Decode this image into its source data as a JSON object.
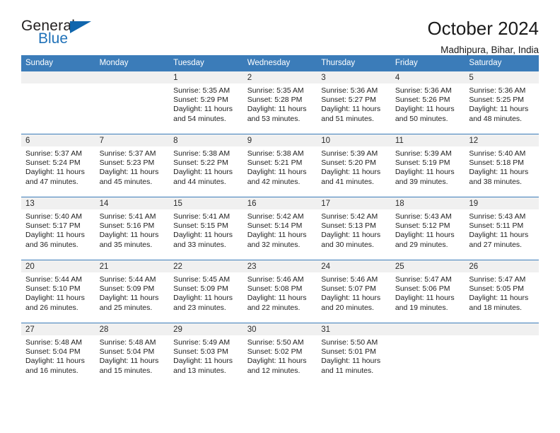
{
  "brand": {
    "name_top": "General",
    "name_bottom": "Blue",
    "accent_color": "#1066ad"
  },
  "header": {
    "title": "October 2024",
    "subtitle": "Madhipura, Bihar, India"
  },
  "theme": {
    "header_row_bg": "#3b7cb9",
    "daynum_bg": "#f0f0f0",
    "text_color": "#222222"
  },
  "labels": {
    "sunrise_prefix": "Sunrise:",
    "sunset_prefix": "Sunset:",
    "daylight_prefix": "Daylight:"
  },
  "weekdays": [
    "Sunday",
    "Monday",
    "Tuesday",
    "Wednesday",
    "Thursday",
    "Friday",
    "Saturday"
  ],
  "weeks": [
    [
      {
        "day": "",
        "empty": true,
        "sunrise": "",
        "sunset": "",
        "daylight_line1": "",
        "daylight_line2": ""
      },
      {
        "day": "",
        "empty": true,
        "sunrise": "",
        "sunset": "",
        "daylight_line1": "",
        "daylight_line2": ""
      },
      {
        "day": "1",
        "sunrise": "Sunrise: 5:35 AM",
        "sunset": "Sunset: 5:29 PM",
        "daylight_line1": "Daylight: 11 hours",
        "daylight_line2": "and 54 minutes."
      },
      {
        "day": "2",
        "sunrise": "Sunrise: 5:35 AM",
        "sunset": "Sunset: 5:28 PM",
        "daylight_line1": "Daylight: 11 hours",
        "daylight_line2": "and 53 minutes."
      },
      {
        "day": "3",
        "sunrise": "Sunrise: 5:36 AM",
        "sunset": "Sunset: 5:27 PM",
        "daylight_line1": "Daylight: 11 hours",
        "daylight_line2": "and 51 minutes."
      },
      {
        "day": "4",
        "sunrise": "Sunrise: 5:36 AM",
        "sunset": "Sunset: 5:26 PM",
        "daylight_line1": "Daylight: 11 hours",
        "daylight_line2": "and 50 minutes."
      },
      {
        "day": "5",
        "sunrise": "Sunrise: 5:36 AM",
        "sunset": "Sunset: 5:25 PM",
        "daylight_line1": "Daylight: 11 hours",
        "daylight_line2": "and 48 minutes."
      }
    ],
    [
      {
        "day": "6",
        "sunrise": "Sunrise: 5:37 AM",
        "sunset": "Sunset: 5:24 PM",
        "daylight_line1": "Daylight: 11 hours",
        "daylight_line2": "and 47 minutes."
      },
      {
        "day": "7",
        "sunrise": "Sunrise: 5:37 AM",
        "sunset": "Sunset: 5:23 PM",
        "daylight_line1": "Daylight: 11 hours",
        "daylight_line2": "and 45 minutes."
      },
      {
        "day": "8",
        "sunrise": "Sunrise: 5:38 AM",
        "sunset": "Sunset: 5:22 PM",
        "daylight_line1": "Daylight: 11 hours",
        "daylight_line2": "and 44 minutes."
      },
      {
        "day": "9",
        "sunrise": "Sunrise: 5:38 AM",
        "sunset": "Sunset: 5:21 PM",
        "daylight_line1": "Daylight: 11 hours",
        "daylight_line2": "and 42 minutes."
      },
      {
        "day": "10",
        "sunrise": "Sunrise: 5:39 AM",
        "sunset": "Sunset: 5:20 PM",
        "daylight_line1": "Daylight: 11 hours",
        "daylight_line2": "and 41 minutes."
      },
      {
        "day": "11",
        "sunrise": "Sunrise: 5:39 AM",
        "sunset": "Sunset: 5:19 PM",
        "daylight_line1": "Daylight: 11 hours",
        "daylight_line2": "and 39 minutes."
      },
      {
        "day": "12",
        "sunrise": "Sunrise: 5:40 AM",
        "sunset": "Sunset: 5:18 PM",
        "daylight_line1": "Daylight: 11 hours",
        "daylight_line2": "and 38 minutes."
      }
    ],
    [
      {
        "day": "13",
        "sunrise": "Sunrise: 5:40 AM",
        "sunset": "Sunset: 5:17 PM",
        "daylight_line1": "Daylight: 11 hours",
        "daylight_line2": "and 36 minutes."
      },
      {
        "day": "14",
        "sunrise": "Sunrise: 5:41 AM",
        "sunset": "Sunset: 5:16 PM",
        "daylight_line1": "Daylight: 11 hours",
        "daylight_line2": "and 35 minutes."
      },
      {
        "day": "15",
        "sunrise": "Sunrise: 5:41 AM",
        "sunset": "Sunset: 5:15 PM",
        "daylight_line1": "Daylight: 11 hours",
        "daylight_line2": "and 33 minutes."
      },
      {
        "day": "16",
        "sunrise": "Sunrise: 5:42 AM",
        "sunset": "Sunset: 5:14 PM",
        "daylight_line1": "Daylight: 11 hours",
        "daylight_line2": "and 32 minutes."
      },
      {
        "day": "17",
        "sunrise": "Sunrise: 5:42 AM",
        "sunset": "Sunset: 5:13 PM",
        "daylight_line1": "Daylight: 11 hours",
        "daylight_line2": "and 30 minutes."
      },
      {
        "day": "18",
        "sunrise": "Sunrise: 5:43 AM",
        "sunset": "Sunset: 5:12 PM",
        "daylight_line1": "Daylight: 11 hours",
        "daylight_line2": "and 29 minutes."
      },
      {
        "day": "19",
        "sunrise": "Sunrise: 5:43 AM",
        "sunset": "Sunset: 5:11 PM",
        "daylight_line1": "Daylight: 11 hours",
        "daylight_line2": "and 27 minutes."
      }
    ],
    [
      {
        "day": "20",
        "sunrise": "Sunrise: 5:44 AM",
        "sunset": "Sunset: 5:10 PM",
        "daylight_line1": "Daylight: 11 hours",
        "daylight_line2": "and 26 minutes."
      },
      {
        "day": "21",
        "sunrise": "Sunrise: 5:44 AM",
        "sunset": "Sunset: 5:09 PM",
        "daylight_line1": "Daylight: 11 hours",
        "daylight_line2": "and 25 minutes."
      },
      {
        "day": "22",
        "sunrise": "Sunrise: 5:45 AM",
        "sunset": "Sunset: 5:09 PM",
        "daylight_line1": "Daylight: 11 hours",
        "daylight_line2": "and 23 minutes."
      },
      {
        "day": "23",
        "sunrise": "Sunrise: 5:46 AM",
        "sunset": "Sunset: 5:08 PM",
        "daylight_line1": "Daylight: 11 hours",
        "daylight_line2": "and 22 minutes."
      },
      {
        "day": "24",
        "sunrise": "Sunrise: 5:46 AM",
        "sunset": "Sunset: 5:07 PM",
        "daylight_line1": "Daylight: 11 hours",
        "daylight_line2": "and 20 minutes."
      },
      {
        "day": "25",
        "sunrise": "Sunrise: 5:47 AM",
        "sunset": "Sunset: 5:06 PM",
        "daylight_line1": "Daylight: 11 hours",
        "daylight_line2": "and 19 minutes."
      },
      {
        "day": "26",
        "sunrise": "Sunrise: 5:47 AM",
        "sunset": "Sunset: 5:05 PM",
        "daylight_line1": "Daylight: 11 hours",
        "daylight_line2": "and 18 minutes."
      }
    ],
    [
      {
        "day": "27",
        "sunrise": "Sunrise: 5:48 AM",
        "sunset": "Sunset: 5:04 PM",
        "daylight_line1": "Daylight: 11 hours",
        "daylight_line2": "and 16 minutes."
      },
      {
        "day": "28",
        "sunrise": "Sunrise: 5:48 AM",
        "sunset": "Sunset: 5:04 PM",
        "daylight_line1": "Daylight: 11 hours",
        "daylight_line2": "and 15 minutes."
      },
      {
        "day": "29",
        "sunrise": "Sunrise: 5:49 AM",
        "sunset": "Sunset: 5:03 PM",
        "daylight_line1": "Daylight: 11 hours",
        "daylight_line2": "and 13 minutes."
      },
      {
        "day": "30",
        "sunrise": "Sunrise: 5:50 AM",
        "sunset": "Sunset: 5:02 PM",
        "daylight_line1": "Daylight: 11 hours",
        "daylight_line2": "and 12 minutes."
      },
      {
        "day": "31",
        "sunrise": "Sunrise: 5:50 AM",
        "sunset": "Sunset: 5:01 PM",
        "daylight_line1": "Daylight: 11 hours",
        "daylight_line2": "and 11 minutes."
      },
      {
        "day": "",
        "empty": true,
        "sunrise": "",
        "sunset": "",
        "daylight_line1": "",
        "daylight_line2": ""
      },
      {
        "day": "",
        "empty": true,
        "sunrise": "",
        "sunset": "",
        "daylight_line1": "",
        "daylight_line2": ""
      }
    ]
  ]
}
